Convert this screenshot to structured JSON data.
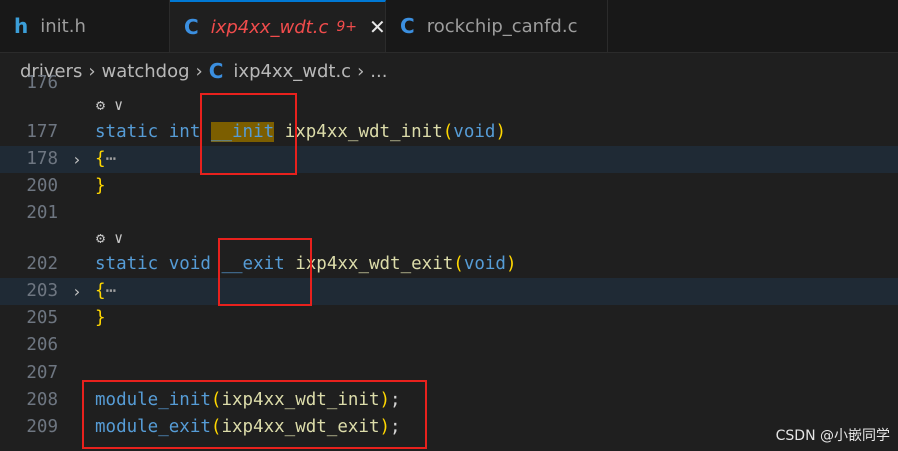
{
  "tabs": [
    {
      "icon": "h",
      "label": "init.h"
    },
    {
      "icon": "C",
      "label": "ixp4xx_wdt.c",
      "badge": "9+",
      "close": "✕"
    },
    {
      "icon": "C",
      "label": "rockchip_canfd.c"
    }
  ],
  "breadcrumb": {
    "parts": [
      "drivers",
      "watchdog"
    ],
    "file_icon": "C",
    "file": "ixp4xx_wdt.c",
    "trail": "...",
    "separator": "›"
  },
  "editor": {
    "partial_top_line": "176",
    "lens_glyph": "⚙",
    "lens_chevron": "∨",
    "lines": [
      {
        "num": "177",
        "kw1": "static",
        "kw2": "int",
        "macro": "__init",
        "fn": "ixp4xx_wdt_init",
        "open": "(",
        "arg": "void",
        "close": ")"
      },
      {
        "num": "178",
        "fold": "›",
        "brace": "{",
        "ellipsis": "⋯"
      },
      {
        "num": "200",
        "brace": "}"
      },
      {
        "num": "201"
      },
      {
        "num": "202",
        "kw1": "static",
        "kw2": "void",
        "macro": "__exit",
        "fn": "ixp4xx_wdt_exit",
        "open": "(",
        "arg": "void",
        "close": ")"
      },
      {
        "num": "203",
        "fold": "›",
        "brace": "{",
        "ellipsis": "⋯"
      },
      {
        "num": "205",
        "brace": "}"
      },
      {
        "num": "206"
      },
      {
        "num": "207"
      },
      {
        "num": "208",
        "call": "module_init",
        "open": "(",
        "arg": "ixp4xx_wdt_init",
        "close": ")",
        "semi": ";"
      },
      {
        "num": "209",
        "call": "module_exit",
        "open": "(",
        "arg": "ixp4xx_wdt_exit",
        "close": ")",
        "semi": ";"
      }
    ]
  },
  "watermark": "CSDN @小嵌同学"
}
